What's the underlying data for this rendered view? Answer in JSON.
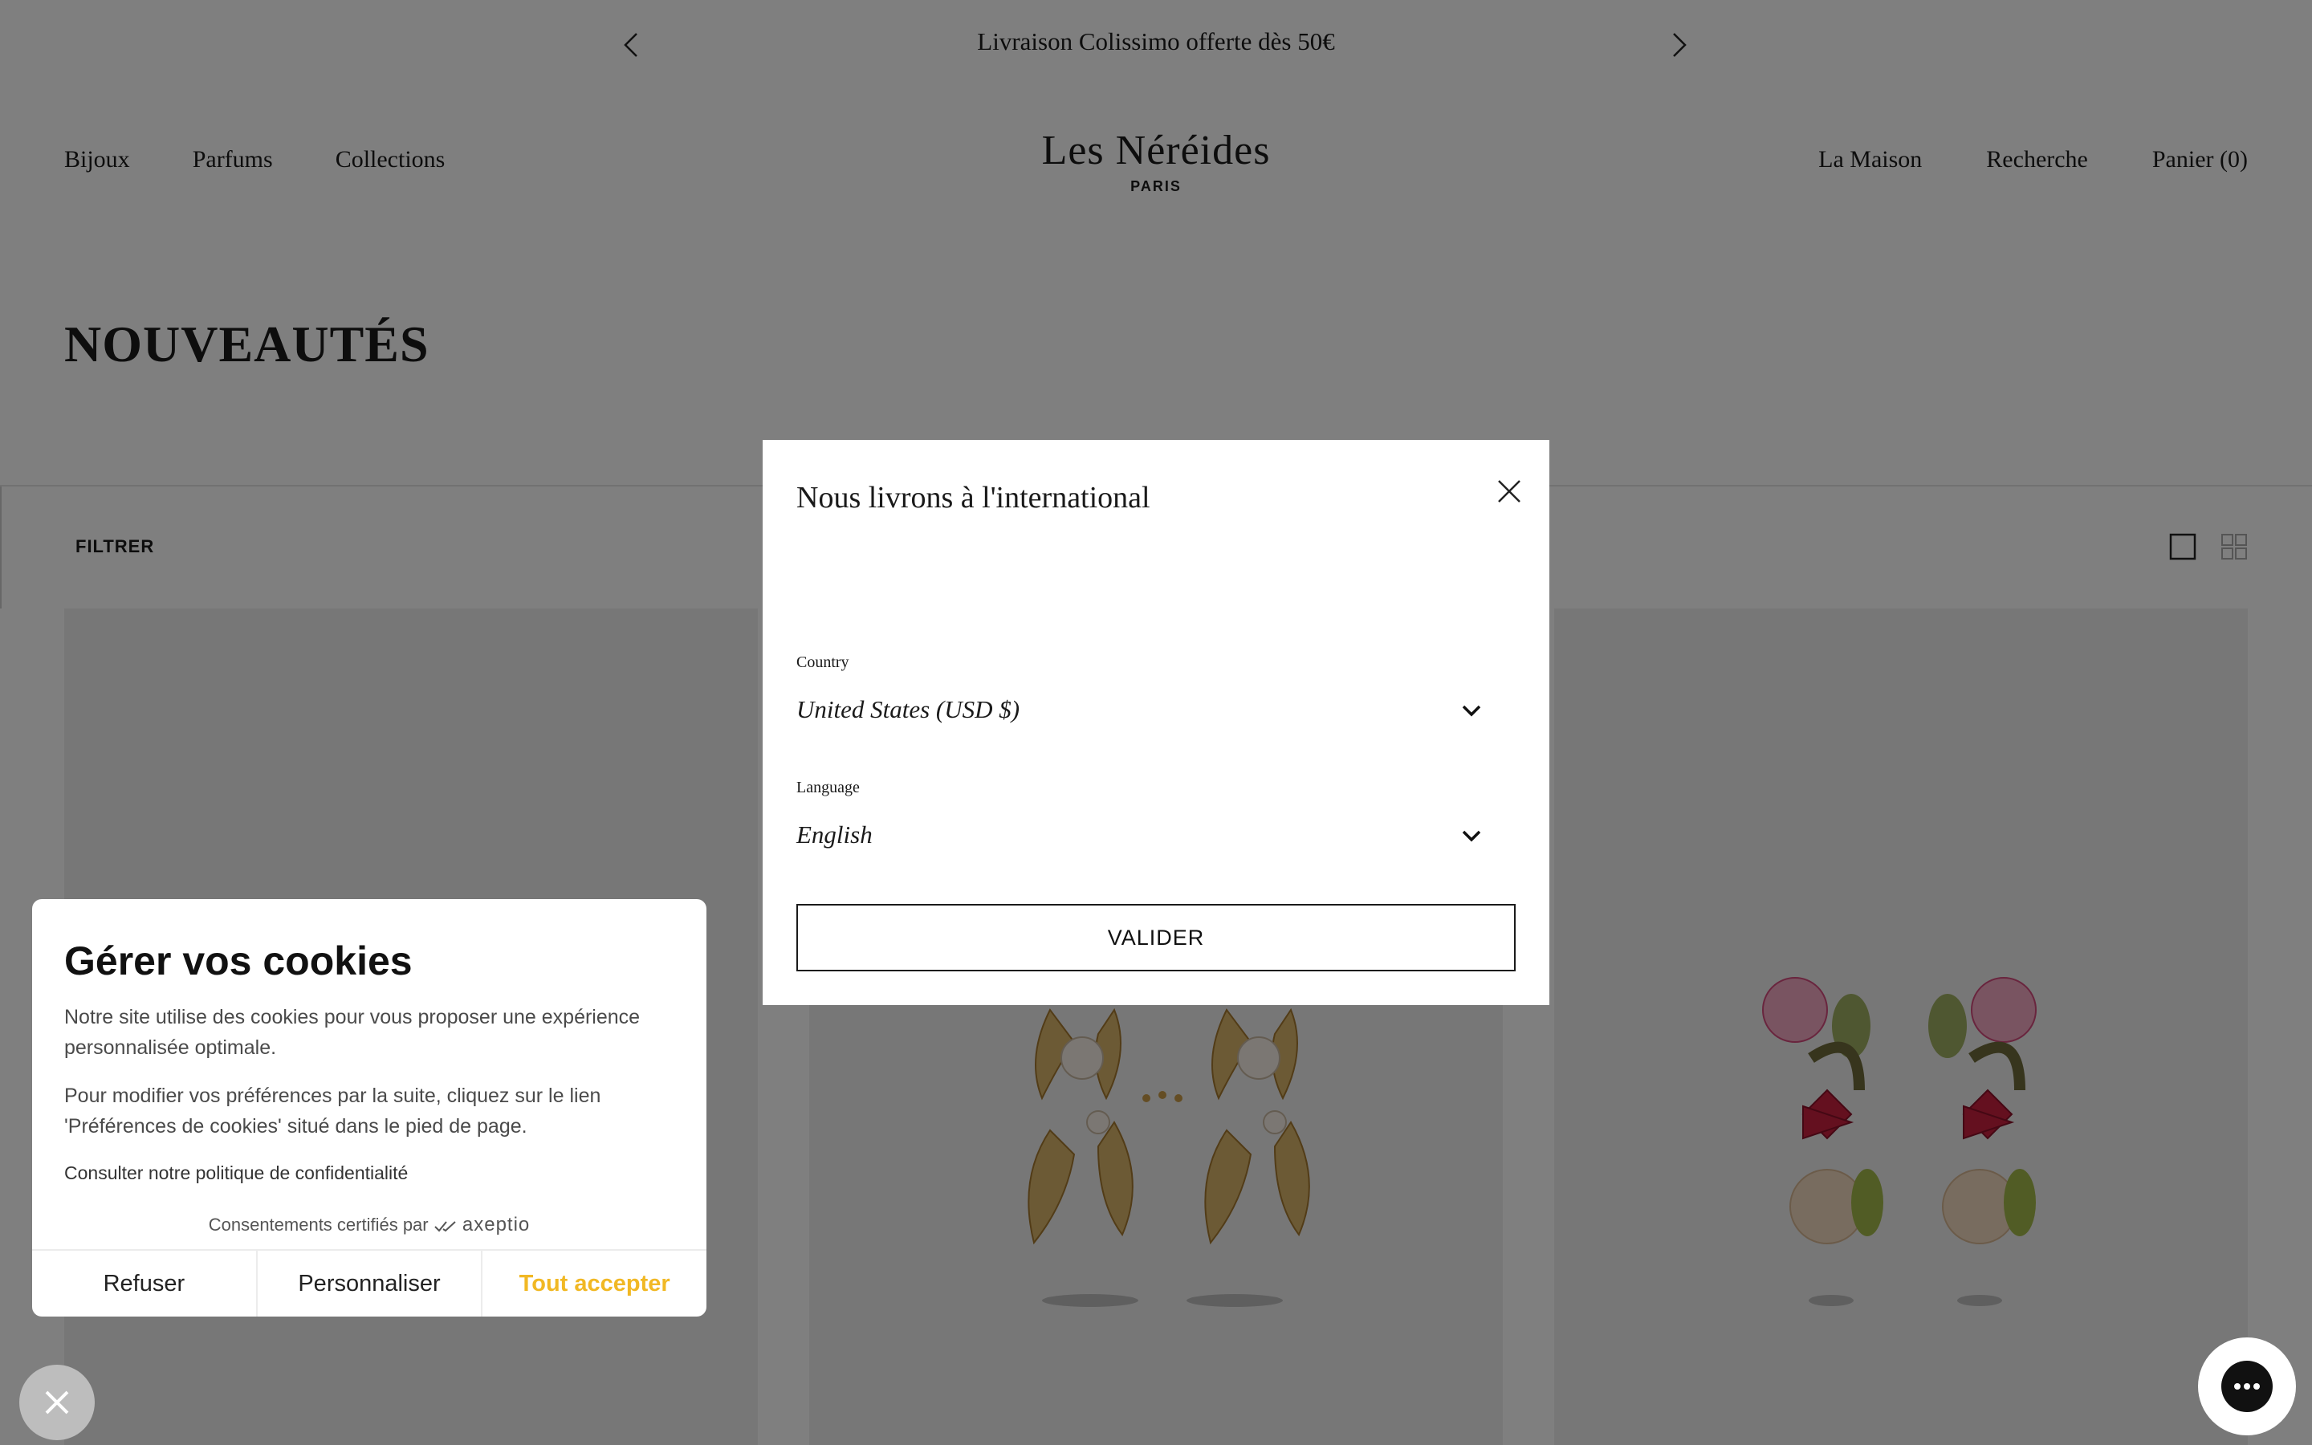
{
  "announcement": {
    "text": "Livraison Colissimo offerte dès 50€",
    "prev_icon": "chevron-left-icon",
    "next_icon": "chevron-right-icon"
  },
  "header": {
    "nav_left": [
      "Bijoux",
      "Parfums",
      "Collections"
    ],
    "logo": {
      "name": "Les Néréides",
      "sub": "PARIS"
    },
    "nav_right": [
      "La Maison",
      "Recherche",
      "Panier (0)"
    ]
  },
  "page": {
    "title": "NOUVEAUTÉS"
  },
  "filter_bar": {
    "label": "FILTRER",
    "view_icons": [
      "single-column-view-icon",
      "grid-view-icon"
    ]
  },
  "modal": {
    "title": "Nous livrons à l'international",
    "country_label": "Country",
    "country_value": "United States (USD $)",
    "language_label": "Language",
    "language_value": "English",
    "submit_label": "VALIDER",
    "close_icon": "close-icon"
  },
  "cookie": {
    "title": "Gérer vos cookies",
    "paragraph1": "Notre site utilise des cookies pour vous proposer une expérience personnalisée optimale.",
    "paragraph2": "Pour modifier vos préférences par la suite, cliquez sur le lien 'Préférences de cookies' situé dans le pied de page.",
    "privacy_link": "Consulter notre politique de confidentialité",
    "certified_text": "Consentements certifiés par",
    "certified_brand": "axeptio",
    "buttons": {
      "refuse": "Refuser",
      "customize": "Personnaliser",
      "accept": "Tout accepter"
    }
  },
  "colors": {
    "accept": "#f1b824",
    "overlay": "rgba(0,0,0,0.5)"
  }
}
